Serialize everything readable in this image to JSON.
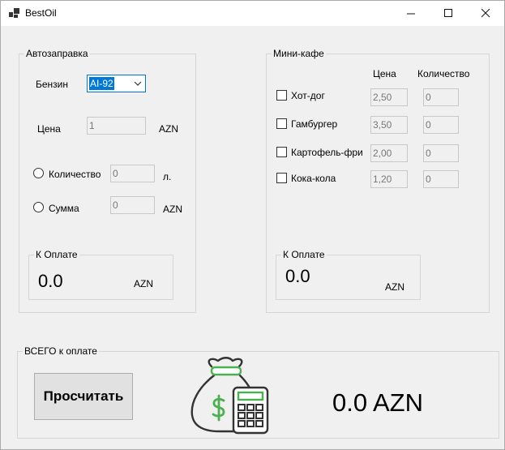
{
  "window": {
    "title": "BestOil",
    "minimize": "—",
    "maximize": "☐",
    "close": "✕"
  },
  "fuel": {
    "legend": "Автозаправка",
    "fuel_label": "Бензин",
    "fuel_selected": "AI-92",
    "price_label": "Цена",
    "price_value": "1",
    "price_currency": "AZN",
    "qty_label": "Количество",
    "qty_value": "0",
    "qty_unit": "л.",
    "sum_label": "Сумма",
    "sum_value": "0",
    "sum_currency": "AZN",
    "pay_legend": "К Оплате",
    "pay_value": "0.0",
    "pay_currency": "AZN"
  },
  "cafe": {
    "legend": "Мини-кафе",
    "price_header": "Цена",
    "qty_header": "Количество",
    "items": [
      {
        "name": "Хот-дог",
        "price": "2,50",
        "qty": "0"
      },
      {
        "name": "Гамбургер",
        "price": "3,50",
        "qty": "0"
      },
      {
        "name": "Картофель-фри",
        "price": "2,00",
        "qty": "0"
      },
      {
        "name": "Кока-кола",
        "price": "1,20",
        "qty": "0"
      }
    ],
    "pay_legend": "К Оплате",
    "pay_value": "0.0",
    "pay_currency": "AZN"
  },
  "total": {
    "legend": "ВСЕГО к оплате",
    "button": "Просчитать",
    "value": "0.0 AZN"
  }
}
